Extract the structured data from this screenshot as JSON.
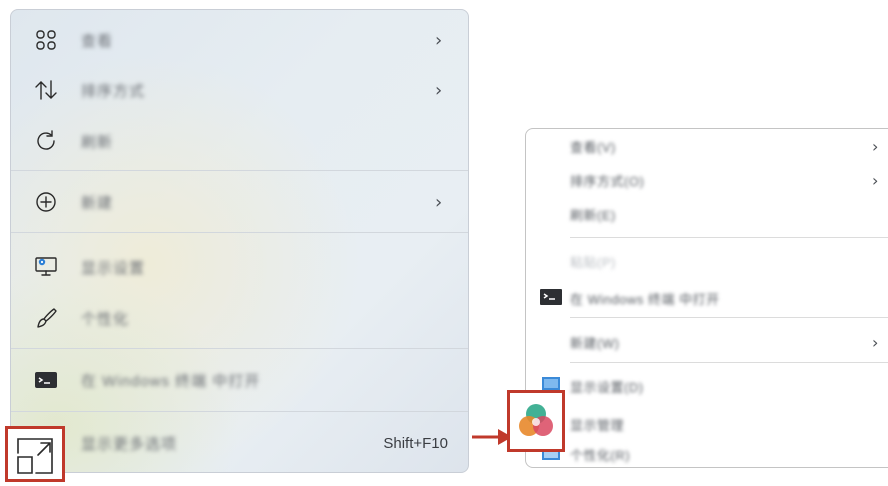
{
  "new_menu": {
    "items": [
      {
        "icon": "grid-icon",
        "label": "查看",
        "has_submenu": true
      },
      {
        "icon": "sort-icon",
        "label": "排序方式",
        "has_submenu": true
      },
      {
        "icon": "refresh-icon",
        "label": "刷新",
        "has_submenu": false
      },
      {
        "icon": "plus-circle-icon",
        "label": "新建",
        "has_submenu": true
      },
      {
        "icon": "display-settings-icon",
        "label": "显示设置",
        "has_submenu": false
      },
      {
        "icon": "brush-icon",
        "label": "个性化",
        "has_submenu": false
      },
      {
        "icon": "terminal-icon",
        "label": "在 Windows 终端 中打开",
        "has_submenu": false
      },
      {
        "icon": "expand-icon",
        "label": "显示更多选项",
        "shortcut": "Shift+F10"
      }
    ],
    "chevron": "›"
  },
  "old_menu": {
    "items": [
      {
        "label": "查看(V)",
        "has_submenu": true
      },
      {
        "label": "排序方式(O)",
        "has_submenu": true
      },
      {
        "label": "刷新(E)",
        "has_submenu": false
      },
      {
        "label": "粘贴(P)",
        "disabled": true
      },
      {
        "label": "在 Windows 终端 中打开",
        "icon": "terminal-icon"
      },
      {
        "label": "新建(W)",
        "has_submenu": true
      },
      {
        "label": "显示设置(D)",
        "icon": "display-icon"
      },
      {
        "label": "显示管理",
        "icon": "color-circles-icon"
      },
      {
        "label": "个性化(R)",
        "icon": "personalize-icon"
      }
    ],
    "chevron": "›"
  },
  "colors": {
    "highlight": "#c0392b",
    "arrow": "#c0392b"
  }
}
